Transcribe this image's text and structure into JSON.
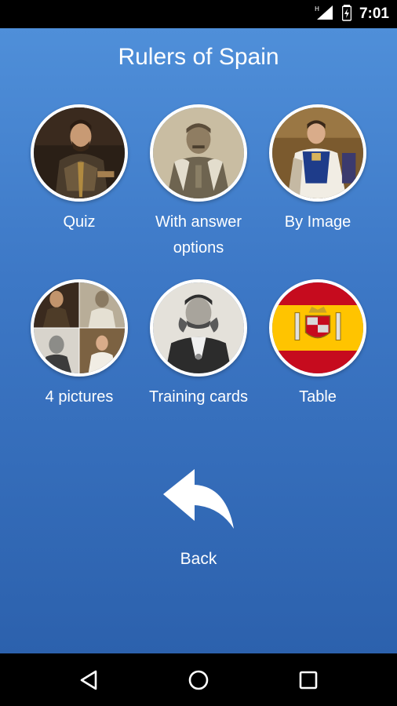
{
  "status_bar": {
    "time": "7:01",
    "icons": [
      "signal-h-icon",
      "battery-icon"
    ]
  },
  "app": {
    "title": "Rulers of Spain"
  },
  "menu": [
    {
      "id": "quiz",
      "label": "Quiz",
      "icon": "knight-portrait"
    },
    {
      "id": "with-answer-options",
      "label": "With answer options",
      "icon": "general-portrait"
    },
    {
      "id": "by-image",
      "label": "By Image",
      "icon": "king-portrait"
    },
    {
      "id": "four-pictures",
      "label": "4 pictures",
      "icon": "collage-portrait"
    },
    {
      "id": "training-cards",
      "label": "Training cards",
      "icon": "gentleman-portrait"
    },
    {
      "id": "table",
      "label": "Table",
      "icon": "spain-flag"
    }
  ],
  "back": {
    "label": "Back",
    "icon": "back-arrow-icon"
  },
  "nav_bar": {
    "buttons": [
      "back-triangle-icon",
      "home-circle-icon",
      "recents-square-icon"
    ]
  },
  "colors": {
    "background_top": "#4f8fd9",
    "background_bottom": "#2c61ad",
    "flag_red": "#c60b1e",
    "flag_yellow": "#ffc400"
  }
}
